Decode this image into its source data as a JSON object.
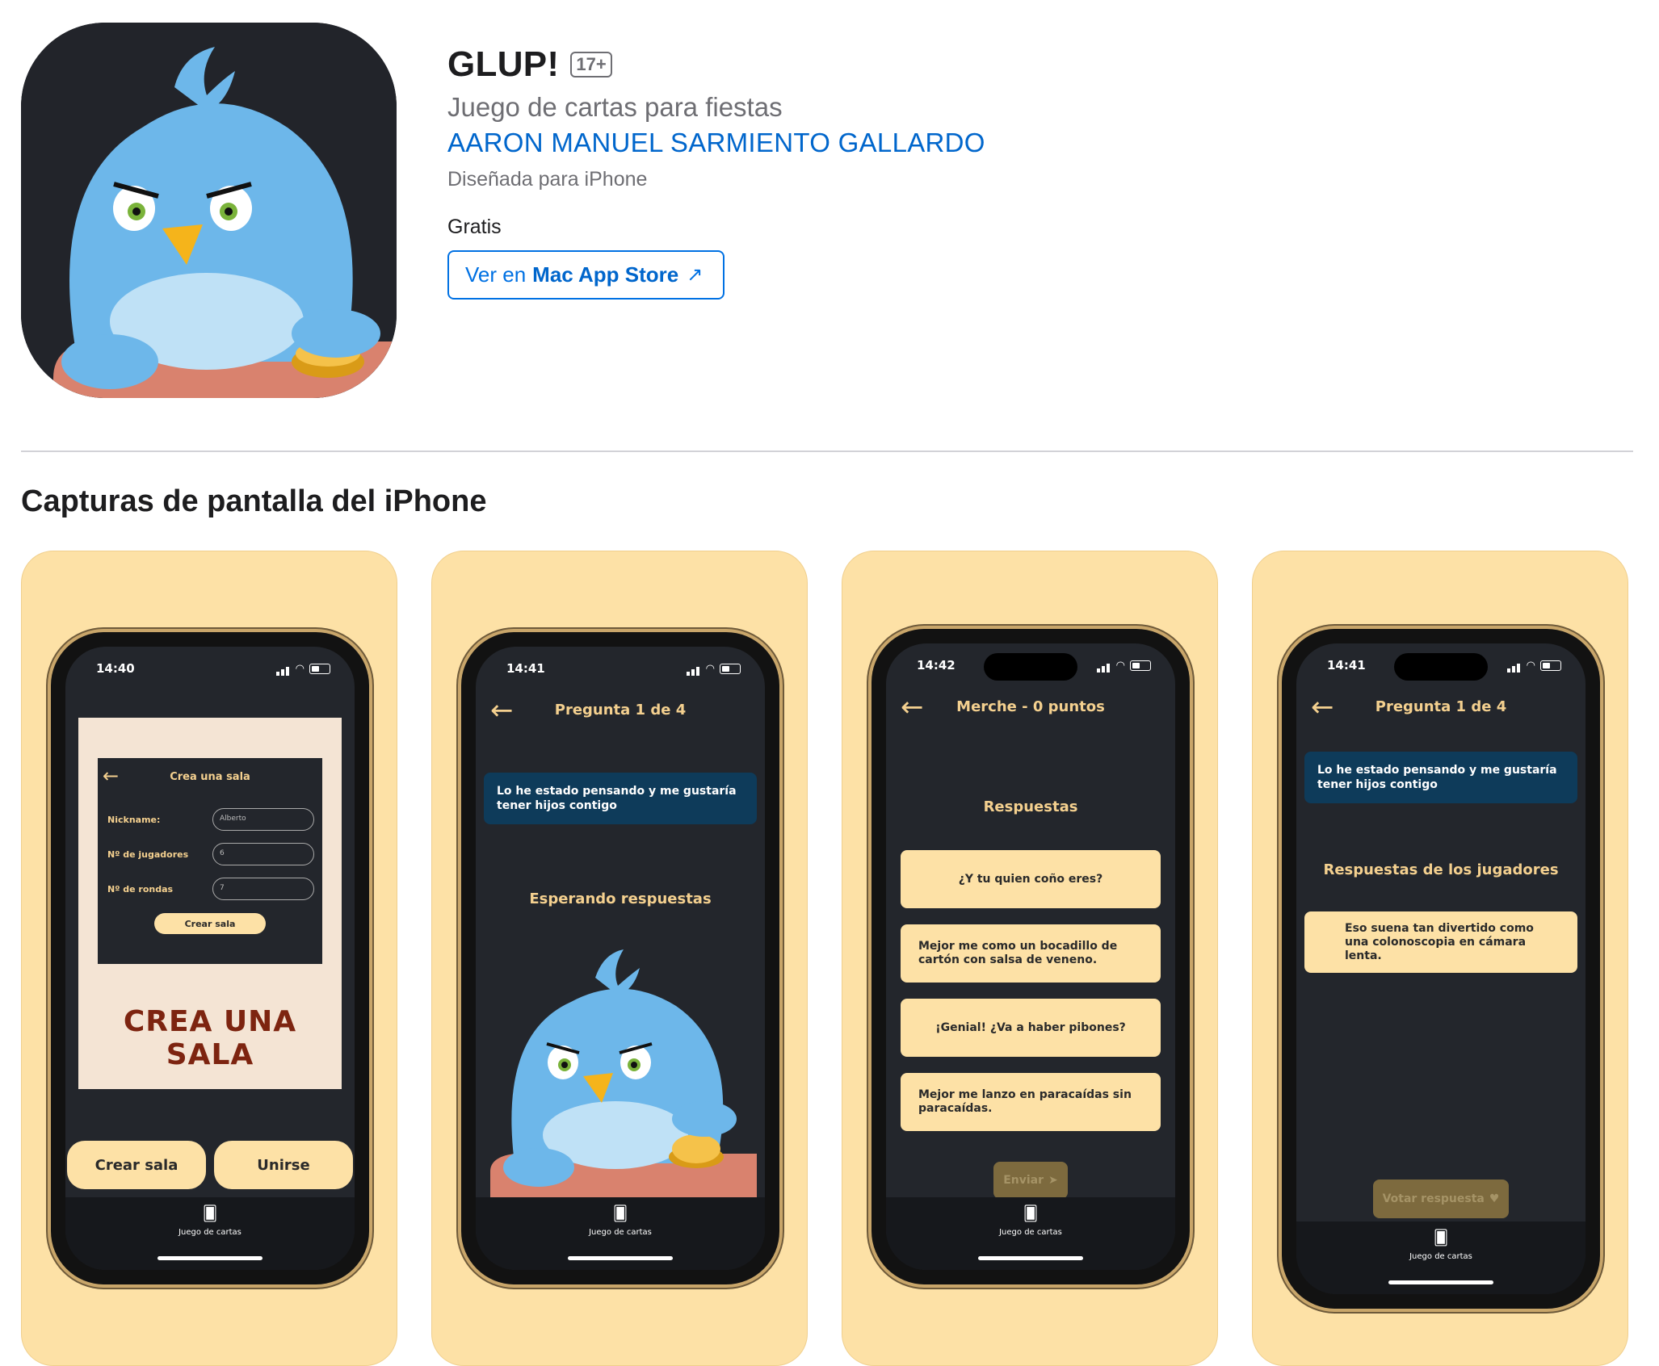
{
  "app": {
    "title": "GLUP!",
    "age_rating": "17+",
    "subtitle": "Juego de cartas para fiestas",
    "developer": "AARON MANUEL SARMIENTO GALLARDO",
    "designed_for": "Diseñada para iPhone",
    "price": "Gratis",
    "store_button_prefix": "Ver en",
    "store_button_strong": "Mac App Store",
    "store_button_icon": "↗"
  },
  "colors": {
    "link": "#0066cc",
    "card_bg": "#fde1a6",
    "screen_bg": "#23262c",
    "accent_text": "#f4d08f",
    "question_bg": "#0e3b5a",
    "promo_caption": "#7d2410"
  },
  "section": {
    "screenshots_title": "Capturas de pantalla del iPhone"
  },
  "screenshots": [
    {
      "time": "14:40",
      "promo_screen_title": "Crea una sala",
      "fields": [
        {
          "label": "Nickname:",
          "value": "Alberto"
        },
        {
          "label": "Nº de jugadores",
          "value": "6"
        },
        {
          "label": "Nº de rondas",
          "value": "7"
        }
      ],
      "promo_button": "Crear sala",
      "promo_caption": "CREA UNA SALA",
      "button_left": "Crear sala",
      "button_right": "Unirse",
      "tab_label": "Juego de cartas"
    },
    {
      "time": "14:41",
      "nav_title": "Pregunta 1 de 4",
      "question": "Lo he estado pensando y me gustaría tener hijos contigo",
      "status_text": "Esperando respuestas",
      "tab_label": "Juego de cartas"
    },
    {
      "time": "14:42",
      "nav_title": "Merche - 0 puntos",
      "section_label": "Respuestas",
      "answers": [
        "¿Y tu quien coño eres?",
        "Mejor me como un bocadillo de cartón con salsa de veneno.",
        "¡Genial! ¿Va a haber pibones?",
        "Mejor me lanzo en paracaídas sin paracaídas."
      ],
      "send_button": "Enviar",
      "tab_label": "Juego de cartas"
    },
    {
      "time": "14:41",
      "nav_title": "Pregunta 1 de 4",
      "question": "Lo he estado pensando y me gustaría tener hijos contigo",
      "section_label": "Respuestas de los jugadores",
      "answer": "Eso suena tan divertido como una colonoscopia en cámara lenta.",
      "vote_button": "Votar respuesta",
      "tab_label": "Juego de cartas"
    }
  ]
}
